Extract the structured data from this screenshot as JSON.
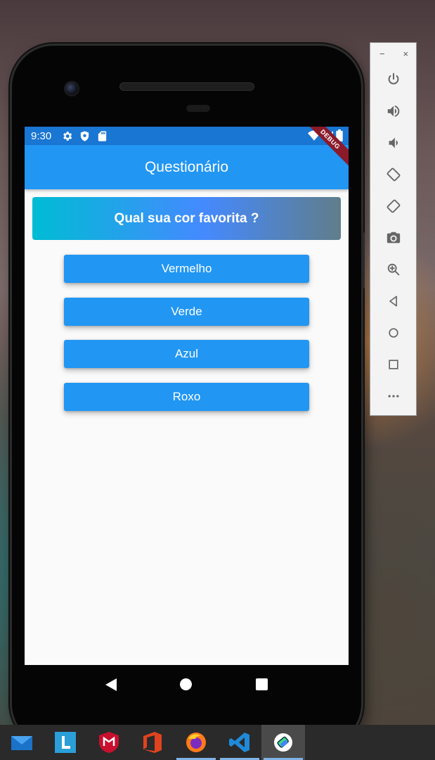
{
  "status_bar": {
    "time": "9:30"
  },
  "app_bar": {
    "title": "Questionário"
  },
  "debug_banner": "DEBUG",
  "question": {
    "text": "Qual sua cor favorita ?"
  },
  "answers": [
    {
      "label": "Vermelho"
    },
    {
      "label": "Verde"
    },
    {
      "label": "Azul"
    },
    {
      "label": "Roxo"
    }
  ],
  "emulator": {
    "minimize_label": "−",
    "close_label": "×",
    "tools": [
      "power-icon",
      "volume-up-icon",
      "volume-down-icon",
      "rotate-left-icon",
      "rotate-right-icon",
      "camera-icon",
      "zoom-icon",
      "back-icon",
      "home-icon",
      "overview-icon",
      "more-icon"
    ]
  },
  "taskbar": {
    "apps": [
      "mail-icon",
      "l-app-icon",
      "mcafee-icon",
      "office-icon",
      "firefox-icon",
      "vscode-icon",
      "android-studio-icon"
    ]
  },
  "colors": {
    "primary": "#2196f3",
    "primary_dark": "#1976d2",
    "gradient_start": "#00bcd4",
    "gradient_mid": "#448aff",
    "gradient_end": "#607d8b",
    "debug_banner": "#8b1a2a"
  }
}
